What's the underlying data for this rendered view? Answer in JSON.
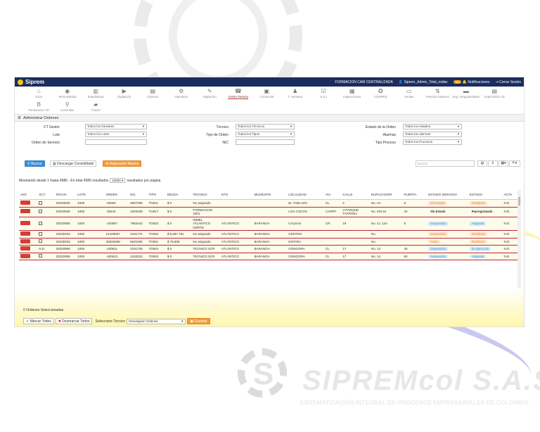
{
  "topbar": {
    "brand": "Siprem",
    "center_title": "FORMACION CAM CENTRALIZADA",
    "user": "Siprem_Admin_Total_midac",
    "badge": "15",
    "notifications": "Notificaciones",
    "logout": "Cerrar Sesión"
  },
  "nav": {
    "items": [
      {
        "label": "Inicio",
        "icon": "⌂"
      },
      {
        "label": "Territorialidad",
        "icon": "◉"
      },
      {
        "label": "Estadisticas",
        "icon": "▥"
      },
      {
        "label": "Digitación",
        "icon": "▶"
      },
      {
        "label": "Almacen",
        "icon": "▤"
      },
      {
        "label": "Operativa",
        "icon": "⚙"
      },
      {
        "label": "Digitación",
        "icon": "✎"
      },
      {
        "label": "Centro Tecnico",
        "icon": "☎"
      },
      {
        "label": "Comercial",
        "icon": "▣"
      },
      {
        "label": "T. Humano",
        "icon": "♟"
      },
      {
        "label": "S.G.I",
        "icon": "☑"
      },
      {
        "label": "Inspecciones",
        "icon": "▦"
      },
      {
        "label": "COMPES",
        "icon": "✪"
      },
      {
        "label": "Ventas",
        "icon": "▭"
      },
      {
        "label": "Petición Ordenes",
        "icon": "⇅"
      },
      {
        "label": "Seg. Irregularidades",
        "icon": "▬"
      },
      {
        "label": "Supervisión CE",
        "icon": "▤"
      },
      {
        "label": "Facturacion CE",
        "icon": "B"
      },
      {
        "label": "Consultas",
        "icon": "⚲"
      },
      {
        "label": "Tractor",
        "icon": "▰"
      }
    ],
    "active_index": 7
  },
  "section": {
    "title": "Administrar Ordenes"
  },
  "filters": {
    "ct_gestor_label": "CT Gestor",
    "ct_gestor_value": "Todos los Gestores",
    "lote_label": "Lote",
    "lote_value": "Todos los Lotes",
    "orden_label": "Orden de Servicio",
    "tecnico_label": "Técnico",
    "tecnico_value": "Todos los Técnicos",
    "tipo_label": "Tipo de Orden",
    "tipo_value": "Todos los Tipos",
    "nic_label": "NIC",
    "estado_label": "Estado de la Orden",
    "estado_value": "Todos los estados",
    "alarmas_label": "Alarmas",
    "alarmas_value": "Todas las alarmas",
    "proceso_label": "Tipo Proceso",
    "proceso_value": "Todos los Procesos"
  },
  "actions": {
    "buscar": "Buscar",
    "descargar": "Descargar Consolidado",
    "asignacion": "Asignación Masiva",
    "search_placeholder": "Buscar"
  },
  "pagination": {
    "showing": "Mostrando desde 1 hasta 4586 - En total 4586 resultados",
    "page_size": "10000",
    "per_page": "resultados por página"
  },
  "table": {
    "headers": [
      "ANT.",
      "SCT",
      "FECHA",
      "LOTE",
      "ORDEN",
      "NIC",
      "TIPO",
      "DEUDA",
      "TECNICO",
      "DTO",
      "MUNICIPIO",
      "LOCALIDAD",
      "VIA",
      "CALLE",
      "DUPLICADOR",
      "PUERTA",
      "ESTADO SERVICIO",
      "ESTADO",
      "ACTA"
    ],
    "rows": [
      {
        "sct": "",
        "fecha": "20220530",
        "lote": "1000",
        "orden": "-35363",
        "nic": "5607259",
        "tipo": "TO811",
        "deuda": "$ 0",
        "tecnico": "No asignado",
        "dto": "",
        "municipio": "",
        "localidad": "EL TABLAZO",
        "via": "CL",
        "calle": "2",
        "duplicador": "No. 4A",
        "puerta": "8",
        "estado_servicio": "Sin Estado",
        "es_style": "orange",
        "estado": "Pendiente",
        "e_style": "orange",
        "acta": "N.D."
      },
      {
        "sct": "",
        "fecha": "20220530",
        "lote": "1000",
        "orden": "-35442",
        "nic": "1002039",
        "tipo": "TO817",
        "deuda": "$ 0",
        "tecnico": "FORMACION 2001",
        "dto": "",
        "municipio": "",
        "localidad": "LOS COCOS",
        "via": "CARRT",
        "calle": "A PARQUE TAYRONA",
        "duplicador": "No. KM 34",
        "puerta": "34",
        "estado_servicio": "Sin Estado",
        "es_style": "bold",
        "estado": "Reprogramada",
        "e_style": "bold",
        "acta": "N.D."
      },
      {
        "sct": "",
        "fecha": "20220906",
        "lote": "1000",
        "orden": "-100567",
        "nic": "7982443",
        "tipo": "TO502",
        "deuda": "$ 0",
        "tecnico": "INMEL ATLÁNTICO NORTE",
        "dto": "ATLÁNTICO",
        "municipio": "BARANOA",
        "localidad": "CALDAS",
        "via": "CR",
        "calle": "19",
        "duplicador": "No. CL 13A",
        "puerta": "5",
        "estado_servicio": "Suspendido",
        "es_style": "blue",
        "estado": "Asignada",
        "e_style": "blue",
        "acta": "N.D."
      },
      {
        "sct": "",
        "fecha": "20230203",
        "lote": "1000",
        "orden": "21428087",
        "nic": "2191774",
        "tipo": "TO253",
        "deuda": "$ 5,087,791",
        "tecnico": "No asignado",
        "dto": "ATLÁNTICO",
        "municipio": "BARANOA",
        "localidad": "CENTRO",
        "via": "",
        "calle": "",
        "duplicador": "No.",
        "puerta": "",
        "estado_servicio": "Suspendido",
        "es_style": "orange",
        "estado": "Pendiente",
        "e_style": "orange",
        "acta": "N.D."
      },
      {
        "sct": "",
        "fecha": "20230203",
        "lote": "1000",
        "orden": "20026088",
        "nic": "6531505",
        "tipo": "TO501",
        "deuda": "$ 78,608",
        "tecnico": "No asignado",
        "dto": "ATLÁNTICO",
        "municipio": "BARANOA",
        "localidad": "ESPAÑA",
        "via": "",
        "calle": "",
        "duplicador": "No.",
        "puerta": "",
        "estado_servicio": "Activo",
        "es_style": "orange",
        "estado": "Pendiente",
        "e_style": "orange",
        "acta": "N.D."
      },
      {
        "sct": "N.D.",
        "fecha": "20220906",
        "lote": "1000",
        "orden": "-100611",
        "nic": "2191735",
        "tipo": "TO503",
        "deuda": "$ 0",
        "tecnico": "TECNICO SCR",
        "dto": "ATLÁNTICO",
        "municipio": "BARANOA",
        "localidad": "GONGORA",
        "via": "CL",
        "calle": "17",
        "duplicador": "No. 14",
        "puerta": "45",
        "estado_servicio": "Suspendido",
        "es_style": "blue",
        "estado": "En Ejecución",
        "e_style": "blue",
        "acta": "N.D."
      },
      {
        "sct": "",
        "fecha": "20220906",
        "lote": "1000",
        "orden": "-100613",
        "nic": "2192023",
        "tipo": "TO503",
        "deuda": "$ 0",
        "tecnico": "TECNICO SCR",
        "dto": "ATLÁNTICO",
        "municipio": "BARANOA",
        "localidad": "GONGORA",
        "via": "CL",
        "calle": "17",
        "duplicador": "No. 14",
        "puerta": "60",
        "estado_servicio": "Suspendido",
        "es_style": "blue",
        "estado": "Asignada",
        "e_style": "blue",
        "acta": "N.D."
      }
    ]
  },
  "bottom": {
    "selected": "0 Ordenes Seleccionadas",
    "marcar": "Marcar Todos",
    "desmarcar": "Desmarcar Todos",
    "seleccione_label": "Seleccione Tecnico",
    "seleccione_value": "Desasignar Ordenes",
    "guardar": "Guardar"
  },
  "watermark": {
    "name": "SIPREMcol S.A.S",
    "tagline": "SISTEMATIZACIÓN INTEGRAL DE PROCESOS EMPRESARIALES DE COLOMBIA"
  },
  "colors": {
    "navy": "#1a2d5e",
    "red": "#c0233b",
    "blue": "#3a8fd8",
    "orange": "#f39c3c"
  }
}
